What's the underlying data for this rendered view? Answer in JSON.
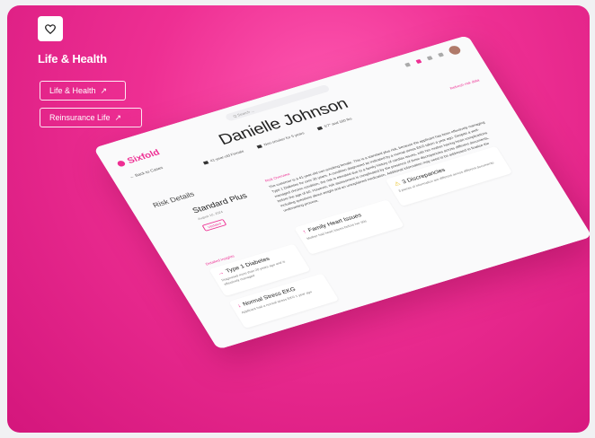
{
  "category": {
    "title": "Life & Health",
    "icon": "heart-icon",
    "links": [
      {
        "label": "Life & Health",
        "arrow": "↗"
      },
      {
        "label": "Reinsurance Life",
        "arrow": "↗"
      }
    ]
  },
  "app": {
    "logo": "Sixfold",
    "back": "← Back to Cases",
    "search_placeholder": "Q  Search ...",
    "applicant_name": "Danielle Johnson",
    "meta": [
      "41-year-old Female",
      "Non-smoker for 5 years",
      "5'7\" and 160 lbs"
    ],
    "refresh": "Refresh risk data",
    "risk_title": "Risk Details",
    "plan": "Standard Plus",
    "plan_sub": "August 10, 2024",
    "plan_badge": "Updated",
    "overview_label": "Risk Overview",
    "overview_text": "The customer is a 41-year-old non-smoking female. This is a standard plus risk, because the applicant has been effectively managing Type 1 Diabetes for over 20 years. A condition diagnosed as indicated by a normal stress EKG taken a year ago. Despite a well-managed chronic condition, the risk is elevated due to a family history of cardiac issues, with her mother having heart complications before the age of 60. However, risk assessment is complicated by the presence of three discrepancies across different documents, including questions about weight and an unexplained medication. Additional information may need to be addressed to finalize the underwriting process.",
    "details_label": "Detailed Insights",
    "cards": [
      {
        "title": "Type 1 Diabetes",
        "desc": "Diagnosed more than 20 years ago and is effectively managed"
      },
      {
        "title": "Family Heart Issues",
        "desc": "Mother had heart issues before her 60s"
      },
      {
        "title": "3 Discrepancies",
        "desc": "3 pieces of information are different across different documents"
      },
      {
        "title": "Normal Stress EKG",
        "desc": "Applicant had a normal stress EKG 1 year ago"
      }
    ]
  },
  "colors": {
    "accent": "#ee2f93",
    "warn": "#e6b800"
  }
}
